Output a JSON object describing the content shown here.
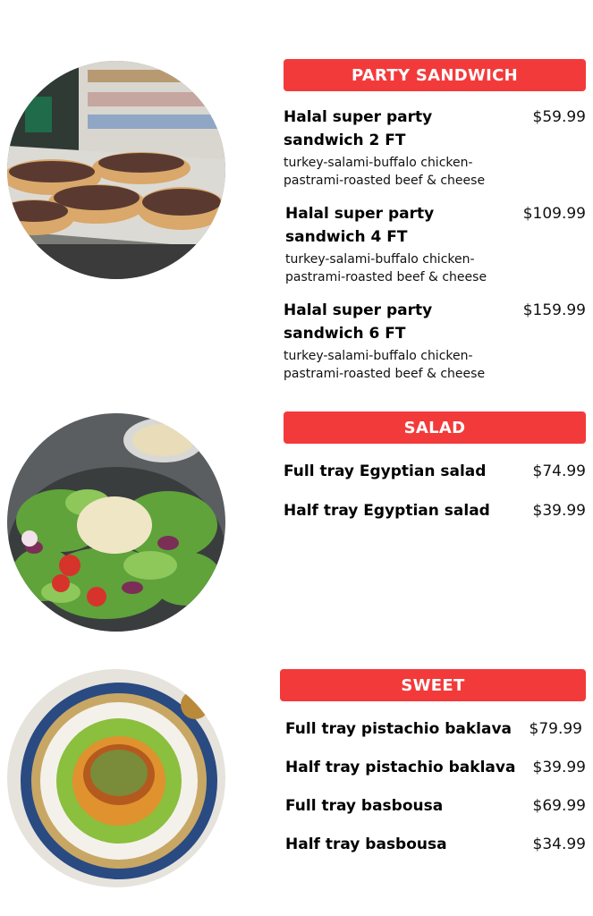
{
  "sections": {
    "party": {
      "title": "PARTY SANDWICH",
      "items": [
        {
          "name": "Halal super party sandwich 2 FT",
          "desc": "turkey-salami-buffalo chicken-pastrami-roasted beef & cheese",
          "price": "$59.99"
        },
        {
          "name": "Halal super party sandwich 4 FT",
          "desc": "turkey-salami-buffalo chicken-pastrami-roasted beef & cheese",
          "price": "$109.99"
        },
        {
          "name": "Halal super party sandwich 6 FT",
          "desc": "turkey-salami-buffalo chicken-pastrami-roasted beef & cheese",
          "price": "$159.99"
        }
      ]
    },
    "salad": {
      "title": "SALAD",
      "items": [
        {
          "name": "Full tray Egyptian salad",
          "price": "$74.99"
        },
        {
          "name": "Half tray Egyptian salad",
          "price": "$39.99"
        }
      ]
    },
    "sweet": {
      "title": "SWEET",
      "items": [
        {
          "name": "Full tray pistachio baklava",
          "price": "$79.99"
        },
        {
          "name": "Half tray pistachio baklava",
          "price": "$39.99"
        },
        {
          "name": "Full tray basbousa",
          "price": "$69.99"
        },
        {
          "name": "Half tray basbousa",
          "price": "$34.99"
        }
      ]
    }
  },
  "colors": {
    "banner": "#f33a3a"
  }
}
